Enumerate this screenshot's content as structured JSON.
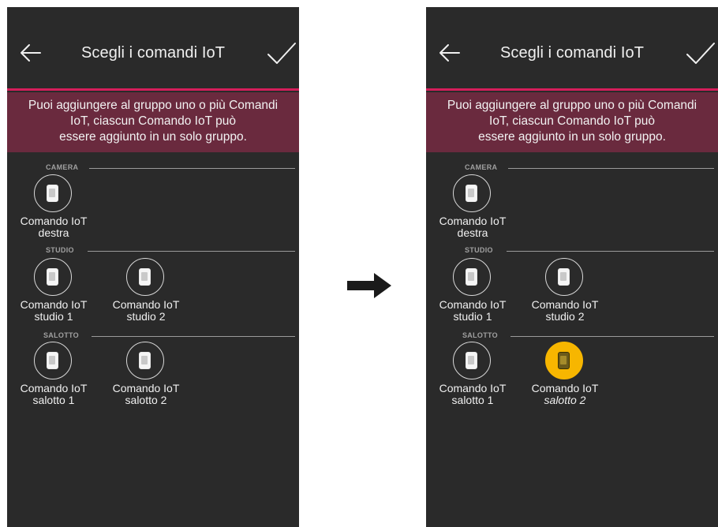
{
  "screens": [
    {
      "title": "Scegli i comandi IoT",
      "info": [
        "Puoi aggiungere al gruppo uno o più Comandi",
        "IoT, ciascun Comando IoT può",
        "essere aggiunto in un solo gruppo."
      ],
      "sections": [
        {
          "label": "CAMERA",
          "items": [
            {
              "line1": "Comando IoT",
              "line2": "destra",
              "selected": false
            }
          ]
        },
        {
          "label": "STUDIO",
          "items": [
            {
              "line1": "Comando IoT",
              "line2": "studio 1",
              "selected": false
            },
            {
              "line1": "Comando IoT",
              "line2": "studio 2",
              "selected": false
            }
          ]
        },
        {
          "label": "SALOTTO",
          "items": [
            {
              "line1": "Comando IoT",
              "line2": "salotto 1",
              "selected": false
            },
            {
              "line1": "Comando IoT",
              "line2": "salotto 2",
              "selected": false
            }
          ]
        }
      ]
    },
    {
      "title": "Scegli i comandi IoT",
      "info": [
        "Puoi aggiungere al gruppo uno o più Comandi",
        "IoT, ciascun Comando IoT può",
        "essere aggiunto in un solo gruppo."
      ],
      "sections": [
        {
          "label": "CAMERA",
          "items": [
            {
              "line1": "Comando IoT",
              "line2": "destra",
              "selected": false
            }
          ]
        },
        {
          "label": "STUDIO",
          "items": [
            {
              "line1": "Comando IoT",
              "line2": "studio 1",
              "selected": false
            },
            {
              "line1": "Comando IoT",
              "line2": "studio 2",
              "selected": false
            }
          ]
        },
        {
          "label": "SALOTTO",
          "items": [
            {
              "line1": "Comando IoT",
              "line2": "salotto 1",
              "selected": false
            },
            {
              "line1": "Comando IoT",
              "line2": "salotto 2",
              "selected": true
            }
          ]
        }
      ]
    }
  ],
  "icons": {
    "back": "arrow-left-icon",
    "confirm": "checkmark-icon",
    "device": "switch-icon",
    "transition": "arrow-right-icon"
  },
  "colors": {
    "background": "#2a2a2a",
    "accent_line": "#d51e5b",
    "info_bar": "#6a2a3e",
    "selected": "#f7b600"
  }
}
